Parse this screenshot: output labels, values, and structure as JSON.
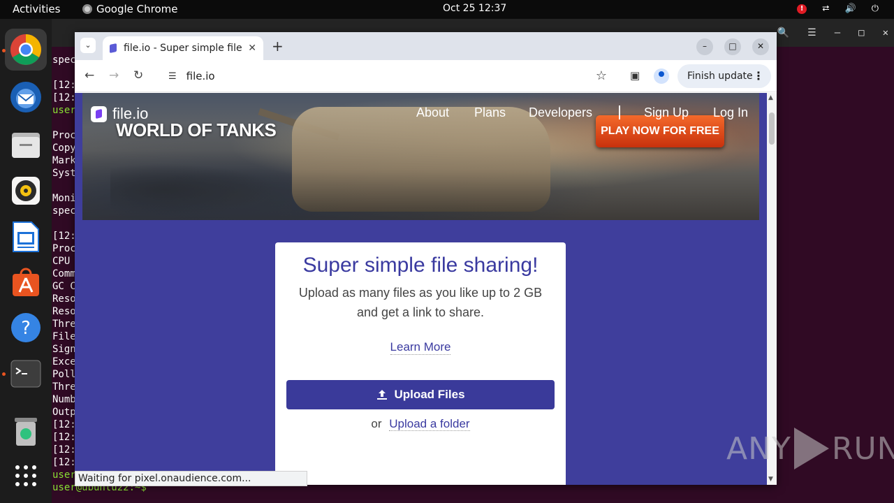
{
  "topbar": {
    "activities": "Activities",
    "app_name": "Google Chrome",
    "clock": "Oct 25  12:37"
  },
  "dock": {
    "items": [
      "Google Chrome",
      "Thunderbird Mail",
      "Files",
      "Rhythmbox",
      "LibreOffice Writer",
      "Ubuntu Software",
      "Help",
      "Terminal",
      "Trash",
      "Show Applications"
    ]
  },
  "terminal": {
    "lines": [
      {
        "text": "spec",
        "color": "white"
      },
      {
        "text": "",
        "color": "white"
      },
      {
        "text": "[12:",
        "color": "white"
      },
      {
        "text": "[12:",
        "color": "white"
      },
      {
        "text": "user",
        "color": "green"
      },
      {
        "text": "",
        "color": "white"
      },
      {
        "text": "Proc",
        "color": "white"
      },
      {
        "text": "Copy",
        "color": "white"
      },
      {
        "text": "Mark",
        "color": "white"
      },
      {
        "text": "Syst",
        "color": "white"
      },
      {
        "text": "",
        "color": "white"
      },
      {
        "text": "Moni",
        "color": "white"
      },
      {
        "text": "spec",
        "color": "white"
      },
      {
        "text": "",
        "color": "white"
      },
      {
        "text": "[12:",
        "color": "white"
      },
      {
        "text": "Proc",
        "color": "white"
      },
      {
        "text": "CPU",
        "color": "white"
      },
      {
        "text": "Comm",
        "color": "white"
      },
      {
        "text": "GC C",
        "color": "white"
      },
      {
        "text": "Reso",
        "color": "white"
      },
      {
        "text": "Reso",
        "color": "white"
      },
      {
        "text": "Thre",
        "color": "white"
      },
      {
        "text": "File",
        "color": "white"
      },
      {
        "text": "Sign",
        "color": "white"
      },
      {
        "text": "Exce",
        "color": "white"
      },
      {
        "text": "Poll",
        "color": "white"
      },
      {
        "text": "Thre",
        "color": "white"
      },
      {
        "text": "Numb",
        "color": "white"
      },
      {
        "text": "Outp",
        "color": "white"
      },
      {
        "text": "[12:",
        "color": "white"
      },
      {
        "text": "[12:",
        "color": "white"
      },
      {
        "text": "[12:",
        "color": "white"
      },
      {
        "text": "[12:",
        "color": "white"
      },
      {
        "text": "user",
        "color": "green"
      },
      {
        "text": "user@ubuntu22:~$ ",
        "color": "green"
      }
    ]
  },
  "chrome": {
    "tab_title": "file.io - Super simple file",
    "url": "file.io",
    "update_label": "Finish update",
    "status_text": "Waiting for pixel.onaudience.com..."
  },
  "site": {
    "logo": "file.io",
    "nav": [
      "About",
      "Plans",
      "Developers",
      "Sign Up",
      "Log In"
    ],
    "banner": {
      "game_logo": "WORLD OF TANKS",
      "cta": "PLAY NOW FOR FREE"
    },
    "card": {
      "headline": "Super simple file sharing!",
      "sub_line1": "Upload as many files as you like up to 2 GB",
      "sub_line2": "and get a link to share.",
      "learn_more": "Learn More",
      "upload_button": "Upload Files",
      "or_text": "or",
      "folder_link": "Upload a folder"
    }
  },
  "watermark": {
    "left": "ANY",
    "right": "RUN"
  }
}
